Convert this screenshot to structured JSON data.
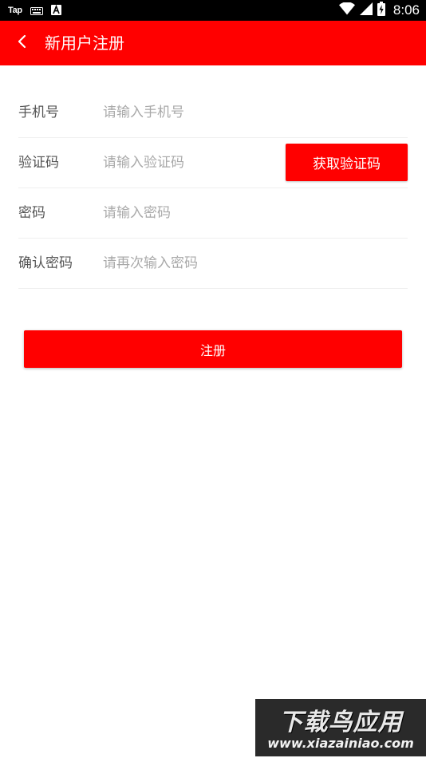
{
  "status_bar": {
    "left_text": "Tap",
    "time": "8:06",
    "icons": [
      "keyboard-icon",
      "a-notification-icon",
      "wifi-icon",
      "signal-icon",
      "battery-icon"
    ]
  },
  "app_bar": {
    "title": "新用户注册",
    "back_icon": "chevron-left-icon",
    "background": "#ff0000"
  },
  "form": {
    "phone": {
      "label": "手机号",
      "placeholder": "请输入手机号",
      "value": ""
    },
    "code": {
      "label": "验证码",
      "placeholder": "请输入验证码",
      "value": "",
      "button": "获取验证码"
    },
    "password": {
      "label": "密码",
      "placeholder": "请输入密码",
      "value": ""
    },
    "confirm": {
      "label": "确认密码",
      "placeholder": "请再次输入密码",
      "value": ""
    }
  },
  "register_button": "注册",
  "watermark": {
    "title": "下载鸟应用",
    "url": "www.xiazainiao.com"
  },
  "colors": {
    "accent": "#ff0000",
    "label": "#555555",
    "placeholder": "#a9a9a9",
    "divider": "#efefef"
  }
}
